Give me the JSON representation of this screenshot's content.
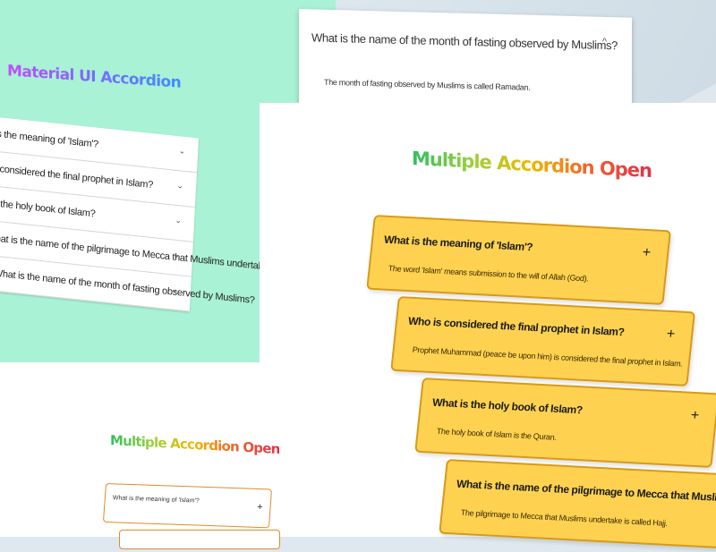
{
  "mui_section": {
    "title": "Material UI Accordion",
    "items": [
      {
        "label": "What is the meaning of 'Islam'?",
        "chevron": "⌄"
      },
      {
        "label": "Who is considered the final prophet in Islam?",
        "chevron": "⌄"
      },
      {
        "label": "What is the holy book of Islam?",
        "chevron": "⌄"
      },
      {
        "label": "What is the name of the pilgrimage to Mecca that Muslims undertake?",
        "chevron": "⌄"
      },
      {
        "label": "What is the name of the month of fasting observed by Muslims?",
        "chevron": "⌄"
      }
    ],
    "expanded": {
      "question": "What is the name of the month of fasting observed by Muslims?",
      "answer": "The month of fasting observed by Muslims is called Ramadan.",
      "chevron": "^"
    }
  },
  "multiple_section": {
    "title": "Multiple Accordion Open",
    "items": [
      {
        "question": "What is the meaning of 'Islam'?",
        "answer": "The word 'Islam' means submission to the will of Allah (God).",
        "toggle": "+"
      },
      {
        "question": "Who is considered the final prophet in Islam?",
        "answer": "Prophet Muhammad (peace be upon him) is considered the final prophet in Islam.",
        "toggle": "+"
      },
      {
        "question": "What is the holy book of Islam?",
        "answer": "The holy book of Islam is the Quran.",
        "toggle": "+"
      },
      {
        "question": "What is the name of the pilgrimage to Mecca that Muslims undertake?",
        "answer": "The pilgrimage to Mecca that Muslims undertake is called Hajj.",
        "toggle": ""
      }
    ]
  },
  "small_section": {
    "title": "Multiple Accordion Open",
    "first_question": "What is the meaning of 'Islam'?",
    "toggle": "+"
  },
  "colors": {
    "mint": "#a9f2d5",
    "yellow": "#fed250",
    "yellow_border": "#d89a1a"
  }
}
